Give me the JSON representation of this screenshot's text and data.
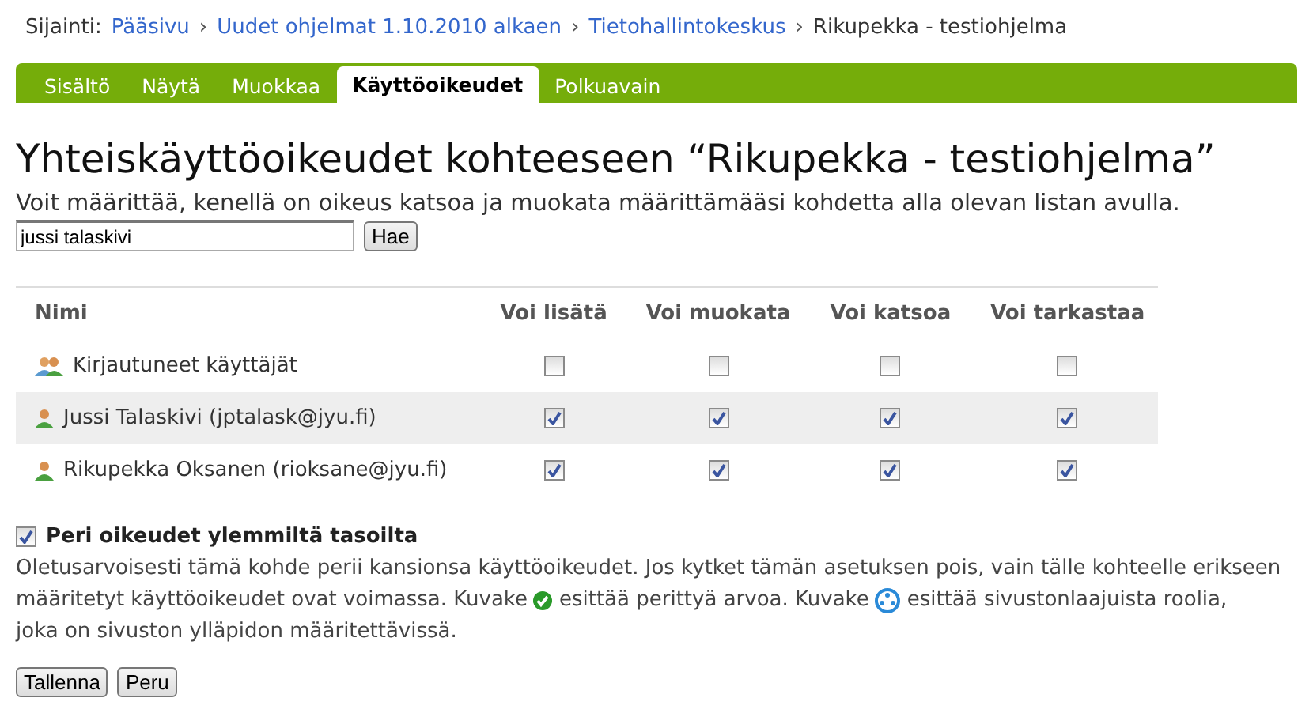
{
  "breadcrumb": {
    "label": "Sijainti:",
    "separator": "›",
    "items": [
      {
        "text": "Pääsivu",
        "kind": "link"
      },
      {
        "text": "Uudet ohjelmat 1.10.2010 alkaen",
        "kind": "link"
      },
      {
        "text": "Tietohallintokeskus",
        "kind": "link"
      },
      {
        "text": "Rikupekka - testiohjelma",
        "kind": "current"
      }
    ]
  },
  "tabs": [
    {
      "label": "Sisältö",
      "selected": false
    },
    {
      "label": "Näytä",
      "selected": false
    },
    {
      "label": "Muokkaa",
      "selected": false
    },
    {
      "label": "Käyttöoikeudet",
      "selected": true
    },
    {
      "label": "Polkuavain",
      "selected": false
    }
  ],
  "heading": "Yhteiskäyttöoikeudet kohteeseen “Rikupekka - testiohjelma”",
  "intro": "Voit määrittää, kenellä on oikeus katsoa ja muokata määrittämääsi kohdetta alla olevan listan avulla.",
  "search": {
    "value": "jussi talaskivi",
    "button": "Hae"
  },
  "table": {
    "columns": [
      "Nimi",
      "Voi lisätä",
      "Voi muokata",
      "Voi katsoa",
      "Voi tarkastaa"
    ],
    "rows": [
      {
        "name": "Kirjautuneet käyttäjät",
        "kind": "group",
        "highlighted": false,
        "permissions": [
          false,
          false,
          false,
          false
        ]
      },
      {
        "name": "Jussi Talaskivi (jptalask@jyu.fi)",
        "kind": "user",
        "highlighted": true,
        "permissions": [
          true,
          true,
          true,
          true
        ]
      },
      {
        "name": "Rikupekka Oksanen (rioksane@jyu.fi)",
        "kind": "user",
        "highlighted": false,
        "permissions": [
          true,
          true,
          true,
          true
        ]
      }
    ]
  },
  "inherit": {
    "label": "Peri oikeudet ylemmiltä tasoilta",
    "checked": true
  },
  "description": [
    [
      {
        "kind": "text",
        "text": "Oletusarvoisesti tämä kohde perii kansionsa käyttöoikeudet. Jos kytket tämän asetuksen pois, vain tälle kohteelle erikseen"
      }
    ],
    [
      {
        "kind": "text",
        "text": "määritetyt käyttöoikeudet ovat voimassa. Kuvake"
      },
      {
        "kind": "inherited-icon"
      },
      {
        "kind": "text",
        "text": "esittää perittyä arvoa. Kuvake"
      },
      {
        "kind": "role-icon"
      },
      {
        "kind": "text",
        "text": "esittää sivustonlaajuista roolia,"
      }
    ],
    [
      {
        "kind": "text",
        "text": "joka on sivuston ylläpidon määritettävissä."
      }
    ]
  ],
  "buttons": [
    "Tallenna",
    "Peru"
  ]
}
